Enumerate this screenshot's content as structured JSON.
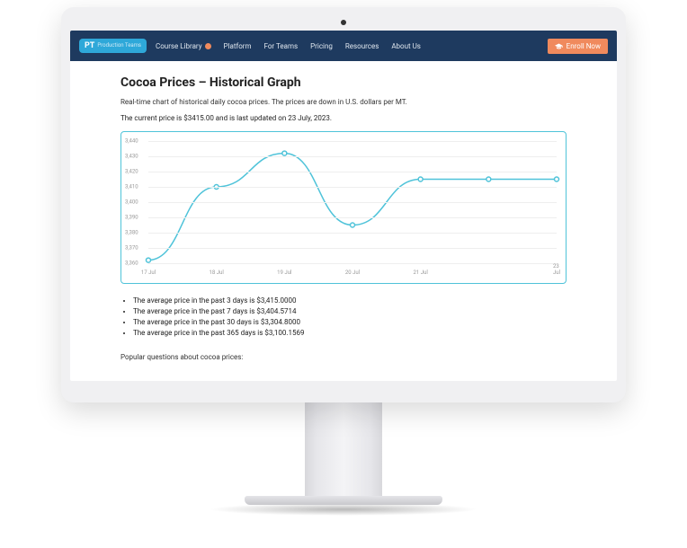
{
  "nav": {
    "logo_pt": "PT",
    "logo_sub": "Production\nTeams",
    "library": "Course Library",
    "items": [
      "Platform",
      "For Teams",
      "Pricing",
      "Resources",
      "About Us"
    ],
    "enroll": "Enroll Now"
  },
  "page": {
    "title": "Cocoa Prices – Historical Graph",
    "desc": "Real-time chart of historical daily cocoa prices. The prices are down in U.S. dollars per MT.",
    "current": "The current price is $3415.00 and is last updated on 23 July, 2023."
  },
  "bullets": [
    "The average price in the past 3 days is $3,415.0000",
    "The average price in the past 7 days is $3,404.5714",
    "The average price in the past 30 days is $3,304.8000",
    "The average price in the past 365 days is $3,100.1569"
  ],
  "popular": "Popular questions about cocoa prices:",
  "chart_data": {
    "type": "line",
    "title": "",
    "xlabel": "",
    "ylabel": "",
    "x_tick_labels": [
      "17 Jul",
      "18 Jul",
      "19 Jul",
      "20 Jul",
      "21 Jul",
      "",
      "23 Jul"
    ],
    "y_ticks": [
      3360,
      3370,
      3380,
      3390,
      3400,
      3410,
      3420,
      3430,
      3440
    ],
    "ylim": [
      3360,
      3440
    ],
    "x": [
      0,
      1,
      2,
      3,
      4,
      5,
      6
    ],
    "values": [
      3362,
      3410,
      3432,
      3385,
      3415,
      3415,
      3415
    ]
  }
}
